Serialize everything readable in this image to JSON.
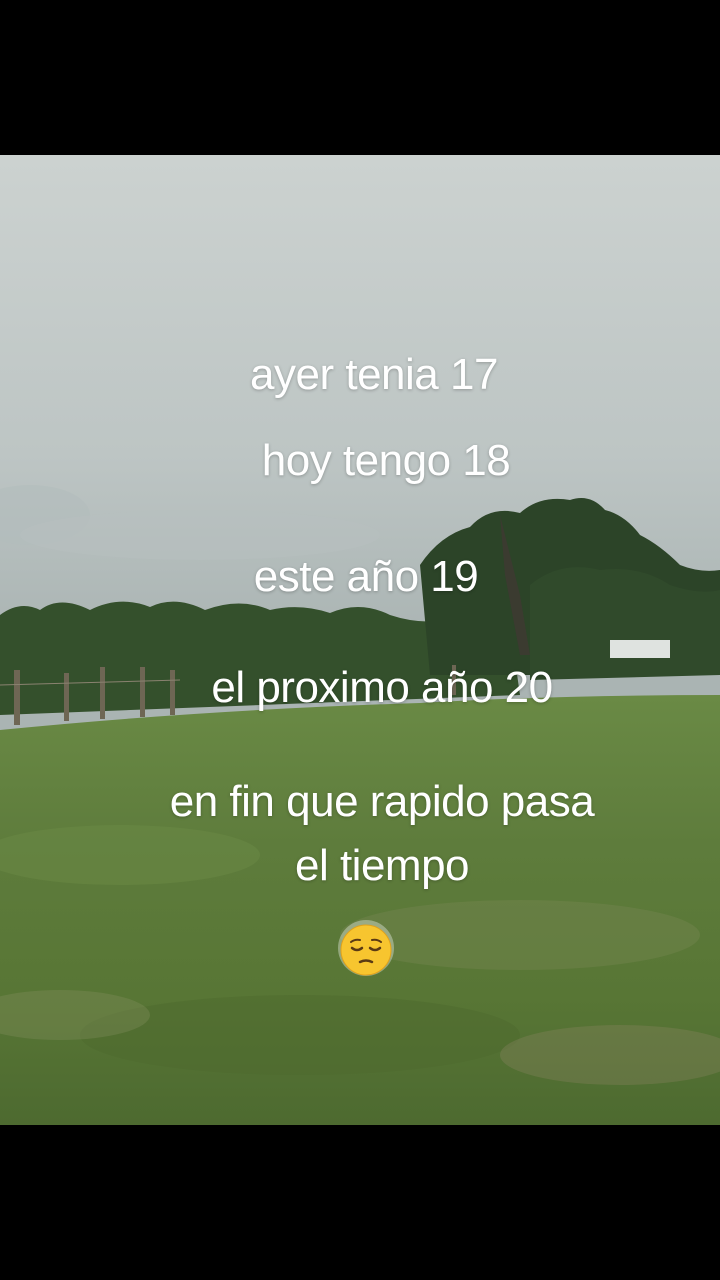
{
  "story": {
    "lines": [
      "ayer tenia 17",
      "hoy tengo 18",
      "este año 19",
      "el proximo año 20",
      "en fin que rapido pasa el tiempo"
    ],
    "emoji": "pensive-face"
  },
  "colors": {
    "text": "#ffffff",
    "sky": "#c6ccca",
    "grass": "#5f7d3e",
    "trees": "#2f4a2a",
    "letterbox": "#000000"
  }
}
